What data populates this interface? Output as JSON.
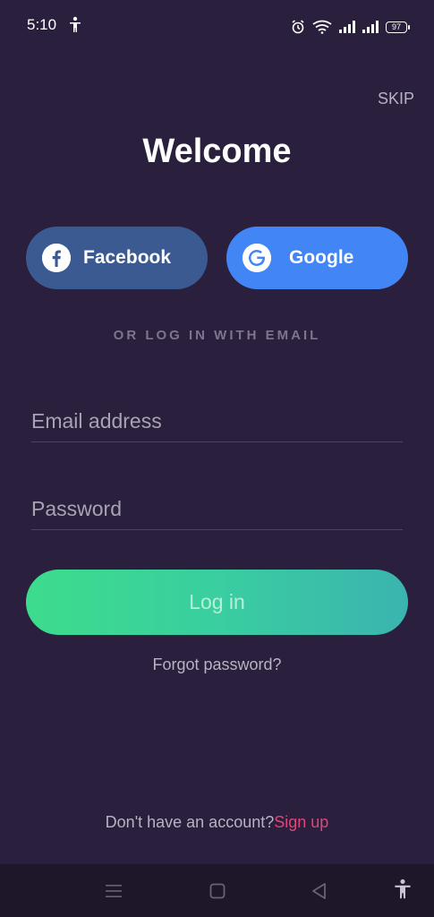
{
  "status_bar": {
    "time": "5:10",
    "battery": "97",
    "icons": [
      "accessibility-icon",
      "alarm-icon",
      "wifi-icon",
      "signal-icon",
      "signal-icon",
      "battery-icon"
    ]
  },
  "header": {
    "skip_label": "SKIP",
    "title": "Welcome"
  },
  "social": {
    "facebook_label": "Facebook",
    "facebook_icon": "facebook-icon",
    "facebook_color": "#3b5a91",
    "google_label": "Google",
    "google_icon": "google-icon",
    "google_color": "#4285f4"
  },
  "divider_text": "OR LOG IN WITH EMAIL",
  "form": {
    "email_placeholder": "Email address",
    "email_value": "",
    "password_placeholder": "Password",
    "password_value": "",
    "login_label": "Log in",
    "forgot_label": "Forgot password?"
  },
  "footer": {
    "prompt": "Don't have an account?",
    "signup_label": "Sign up",
    "signup_color": "#e0457b"
  },
  "nav_bar": {
    "icons": [
      "menu-icon",
      "home-icon",
      "back-icon",
      "accessibility-icon"
    ]
  },
  "colors": {
    "background": "#2a1f3d",
    "login_gradient_start": "#3ddc8c",
    "login_gradient_end": "#3bb4b0"
  }
}
